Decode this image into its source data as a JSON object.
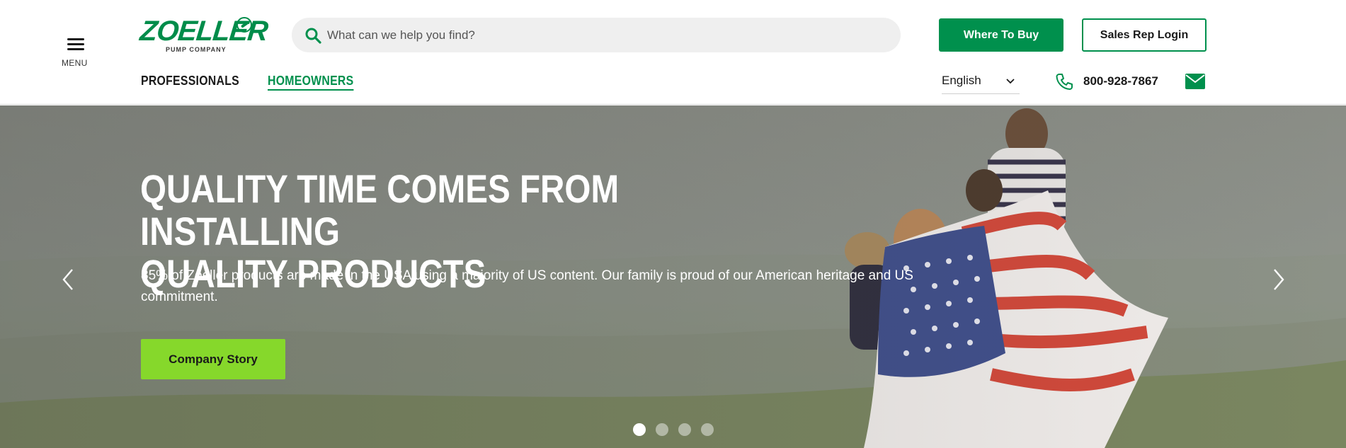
{
  "header": {
    "menu_label": "MENU",
    "logo": {
      "name": "ZOELLER",
      "subtitle": "PUMP COMPANY"
    },
    "search": {
      "placeholder": "What can we help you find?",
      "value": ""
    },
    "where_to_buy_label": "Where To Buy",
    "sales_rep_login_label": "Sales Rep Login",
    "nav": [
      {
        "label": "PROFESSIONALS",
        "active": false
      },
      {
        "label": "HOMEOWNERS",
        "active": true
      }
    ],
    "language": {
      "selected": "English"
    },
    "phone": "800-928-7867"
  },
  "hero": {
    "title_line1": "QUALITY TIME COMES FROM INSTALLING",
    "title_line2": "QUALITY PRODUCTS",
    "subtitle": "85% of Zoeller products are made in the USA using a majority of US content. Our family is proud of our American heritage and US commitment.",
    "cta_label": "Company Story",
    "slides": {
      "count": 4,
      "active_index": 0
    }
  },
  "colors": {
    "brand_green": "#00904d",
    "cta_green": "#86d82b",
    "text_dark": "#1a1a1a"
  },
  "icons": [
    "menu-icon",
    "search-icon",
    "chevron-down-icon",
    "phone-icon",
    "mail-icon",
    "arrow-left-icon",
    "arrow-right-icon"
  ]
}
